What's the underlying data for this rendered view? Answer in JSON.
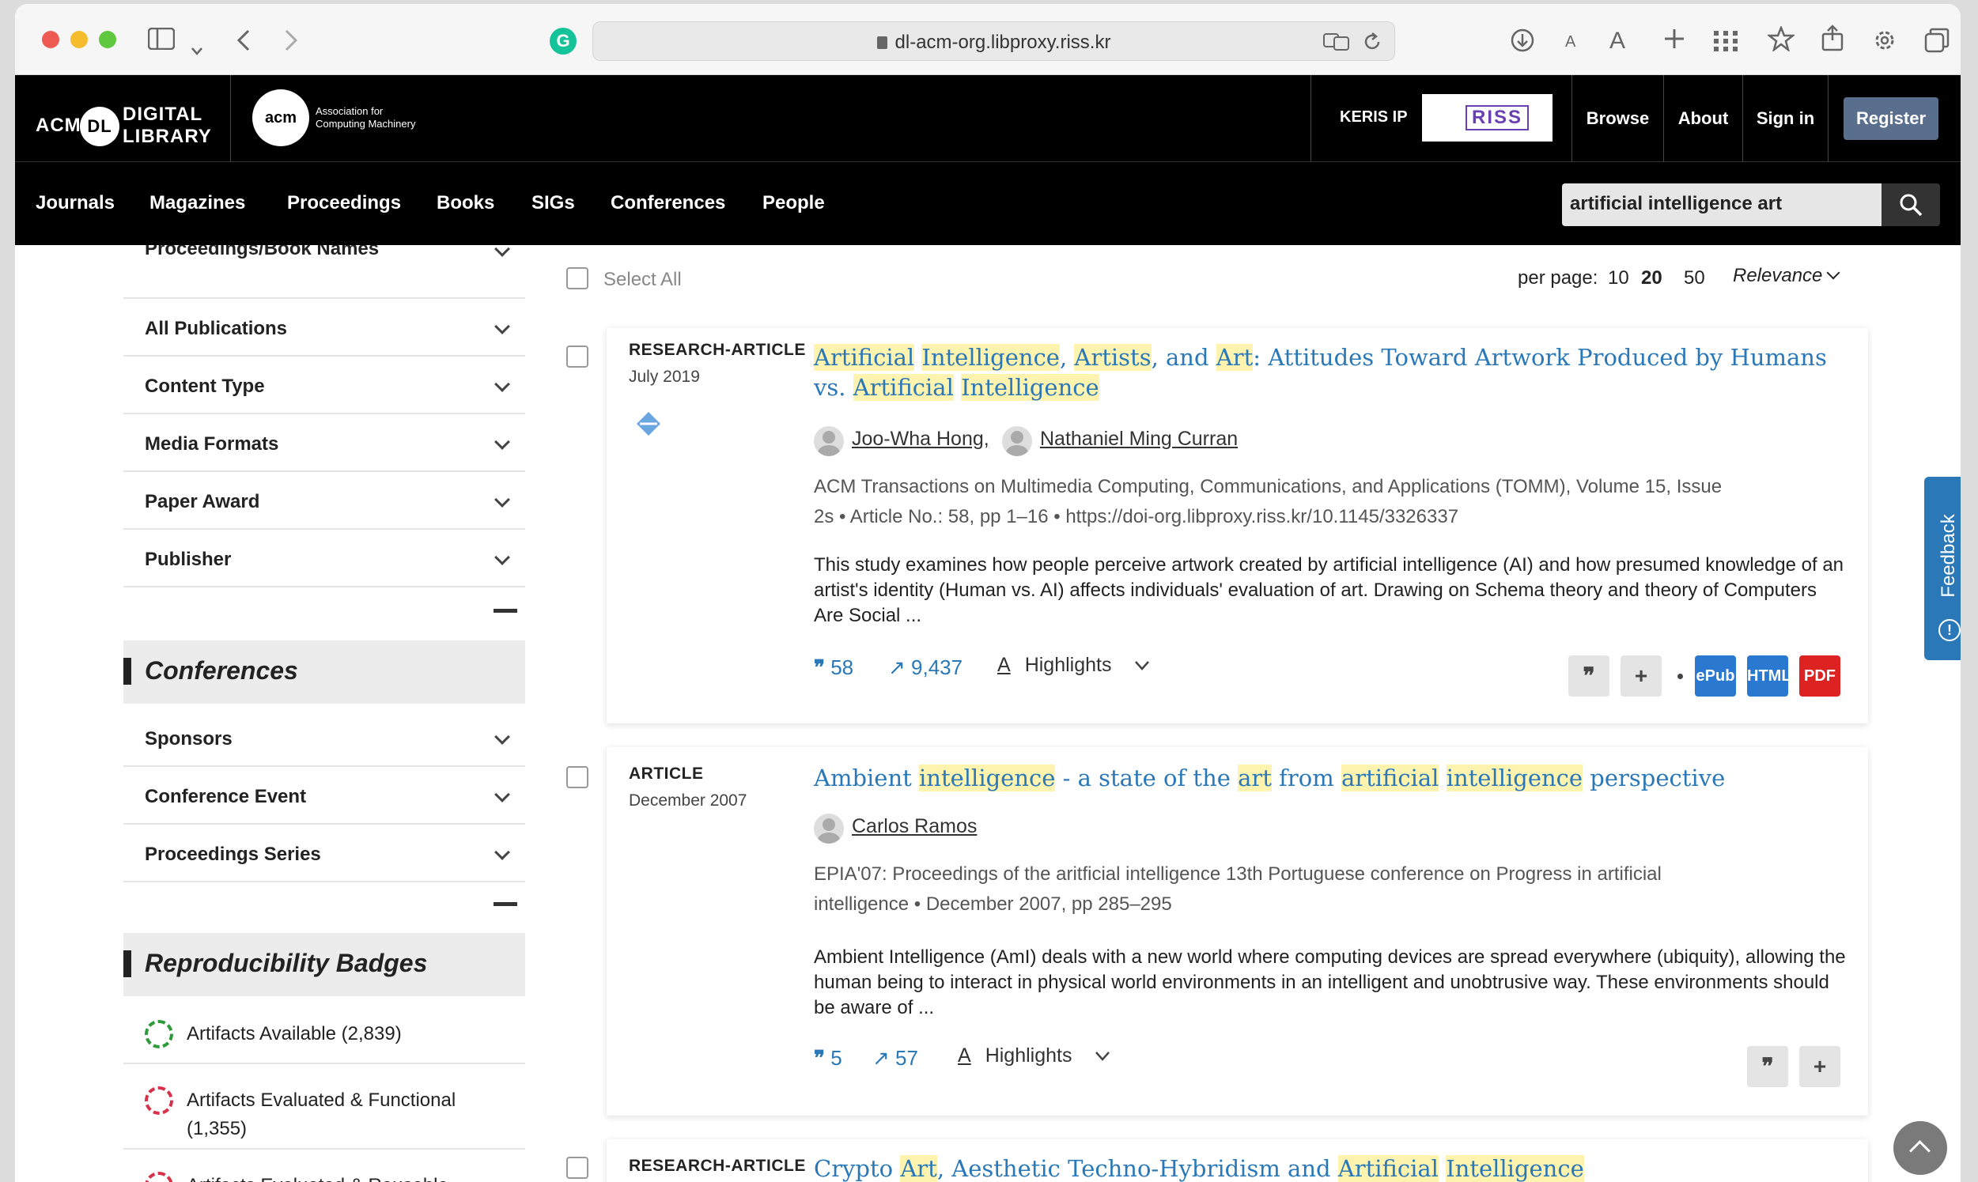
{
  "browser": {
    "url": "dl-acm-org.libproxy.riss.kr",
    "font_small": "A",
    "font_large": "A"
  },
  "header": {
    "dl_logo_acm": "ACM",
    "dl_logo_mark": "DL",
    "dl_logo_line1": "DIGITAL",
    "dl_logo_line2": "LIBRARY",
    "acm_logo": "acm",
    "acm_assoc": "Association for Computing Machinery",
    "keris_label": "KERIS IP",
    "riss_logo": "RISS",
    "browse": "Browse",
    "about": "About",
    "sign_in": "Sign in",
    "register": "Register"
  },
  "nav": {
    "items": [
      "Journals",
      "Magazines",
      "Proceedings",
      "Books",
      "SIGs",
      "Conferences",
      "People"
    ],
    "search_value": "artificial intelligence art"
  },
  "sidebar": {
    "cut_facet": "Proceedings/Book Names",
    "facets": [
      "All Publications",
      "Content Type",
      "Media Formats",
      "Paper Award",
      "Publisher"
    ],
    "conferences_title": "Conferences",
    "conference_facets": [
      "Sponsors",
      "Conference Event",
      "Proceedings Series"
    ],
    "badges_title": "Reproducibility Badges",
    "badges": [
      "Artifacts Available (2,839)",
      "Artifacts Evaluated & Functional (1,355)",
      "Artifacts Evaluated & Reusable"
    ]
  },
  "results_controls": {
    "select_all": "Select All",
    "per_page_label": "per page:",
    "per_page_options": [
      "10",
      "20",
      "50"
    ],
    "sort": "Relevance"
  },
  "results": [
    {
      "type": "RESEARCH-ARTICLE",
      "date": "July 2019",
      "title_parts": [
        {
          "t": "Artificial",
          "h": true
        },
        {
          "t": " ",
          "h": false
        },
        {
          "t": "Intelligence",
          "h": true
        },
        {
          "t": ", ",
          "h": false
        },
        {
          "t": "Artists",
          "h": true
        },
        {
          "t": ", and ",
          "h": false
        },
        {
          "t": "Art",
          "h": true
        },
        {
          "t": ": Attitudes Toward Artwork Produced by Humans vs. ",
          "h": false
        },
        {
          "t": "Artificial",
          "h": true
        },
        {
          "t": " ",
          "h": false
        },
        {
          "t": "Intelligence",
          "h": true
        }
      ],
      "authors": [
        "Joo-Wha Hong,",
        "Nathaniel Ming Curran"
      ],
      "pub_line1": "ACM Transactions on Multimedia Computing, Communications, and Applications (TOMM), Volume 15, Issue",
      "pub_line2": "2s • Article No.: 58, pp 1–16 • https://doi-org.libproxy.riss.kr/10.1145/3326337",
      "abstract": "This study examines how people perceive artwork created by artificial intelligence (AI) and how presumed knowledge of an artist's identity (Human vs. AI) affects individuals' evaluation of art. Drawing on Schema theory and theory of Computers Are Social ...",
      "citations": "58",
      "downloads": "9,437",
      "highlights": "Highlights",
      "open_access_badge": "OA"
    },
    {
      "type": "ARTICLE",
      "date": "December 2007",
      "title_parts": [
        {
          "t": "Ambient ",
          "h": false
        },
        {
          "t": "intelligence",
          "h": true
        },
        {
          "t": " - a state of the ",
          "h": false
        },
        {
          "t": "art",
          "h": true
        },
        {
          "t": " from ",
          "h": false
        },
        {
          "t": "artificial",
          "h": true
        },
        {
          "t": " ",
          "h": false
        },
        {
          "t": "intelligence",
          "h": true
        },
        {
          "t": " perspective",
          "h": false
        }
      ],
      "authors": [
        "Carlos Ramos"
      ],
      "pub_line1": "EPIA'07: Proceedings of the aritficial intelligence 13th Portuguese conference on Progress in artificial",
      "pub_line2": "intelligence • December 2007, pp 285–295",
      "abstract": "Ambient Intelligence (AmI) deals with a new world where computing devices are spread everywhere (ubiquity), allowing the human being to interact in physical world environments in an intelligent and unobtrusive way. These environments should be aware of ...",
      "citations": "5",
      "downloads": "57",
      "highlights": "Highlights"
    },
    {
      "type": "RESEARCH-ARTICLE",
      "title_parts": [
        {
          "t": "Crypto ",
          "h": false
        },
        {
          "t": "Art",
          "h": true
        },
        {
          "t": ", Aesthetic Techno-Hybridism and ",
          "h": false
        },
        {
          "t": "Artificial",
          "h": true
        },
        {
          "t": " ",
          "h": false
        },
        {
          "t": "Intelligence",
          "h": true
        }
      ]
    }
  ],
  "feedback": "Feedback",
  "colors": {
    "link": "#2a78b8",
    "highlight": "#fff3b0",
    "register": "#5a6f8e",
    "pdf": "#d22",
    "html": "#2a78d0"
  }
}
